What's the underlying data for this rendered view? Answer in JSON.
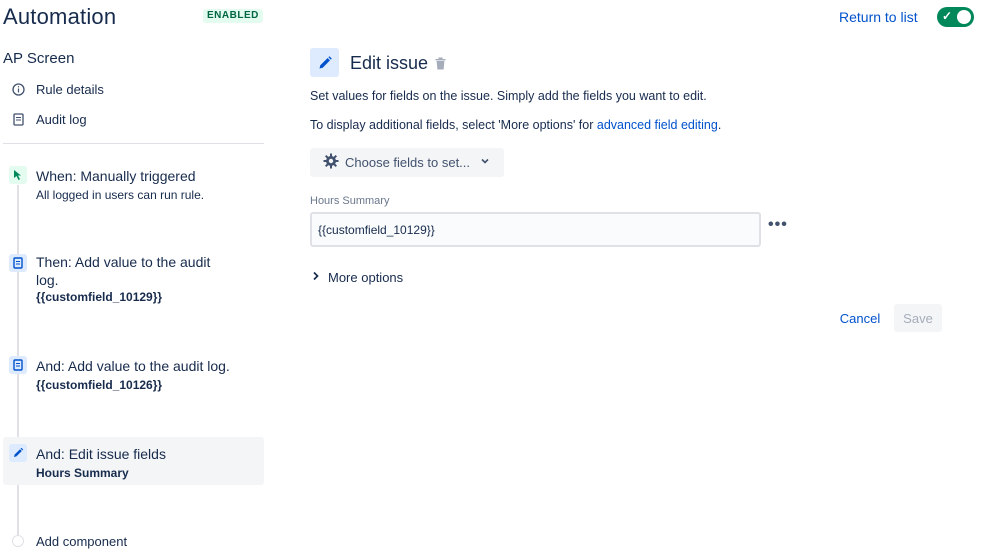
{
  "header": {
    "title": "Automation",
    "status_badge": "ENABLED",
    "return_link": "Return to list",
    "toggle_on": true
  },
  "sidebar": {
    "rule_name": "AP Screen",
    "nav": [
      {
        "label": "Rule details",
        "icon": "info-icon"
      },
      {
        "label": "Audit log",
        "icon": "document-icon"
      }
    ],
    "steps": [
      {
        "title": "When: Manually triggered",
        "subtitle": "All logged in users can run rule.",
        "icon": "cursor-click-icon"
      },
      {
        "title_line1": "Then: Add value to the audit",
        "title_line2": "log.",
        "subtitle": "{{customfield_10129}}",
        "icon": "document-icon"
      },
      {
        "title": "And: Add value to the audit log.",
        "subtitle": "{{customfield_10126}}",
        "icon": "document-icon"
      },
      {
        "title": "And: Edit issue fields",
        "subtitle": "Hours Summary",
        "icon": "pencil-icon",
        "selected": true
      }
    ],
    "add_component": "Add component"
  },
  "panel": {
    "title": "Edit issue",
    "description": "Set values for fields on the issue. Simply add the fields you want to edit.",
    "additional_prefix": "To display additional fields, select 'More options' for ",
    "additional_link": "advanced field editing",
    "additional_suffix": ".",
    "choose_fields_label": "Choose fields to set...",
    "field_label": "Hours Summary",
    "field_value": "{{customfield_10129}}",
    "more_options": "More options",
    "cancel": "Cancel",
    "save": "Save"
  },
  "colors": {
    "accent": "#0052cc",
    "toggle_on": "#00875a",
    "badge_bg": "#e3fcef",
    "badge_text": "#006644",
    "selected_bg": "#f4f5f7"
  }
}
